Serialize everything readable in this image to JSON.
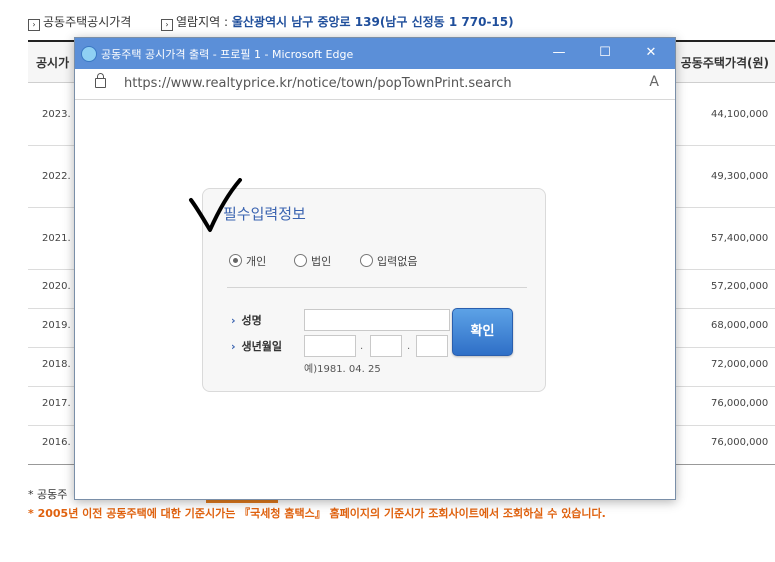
{
  "header": {
    "price_label": "공동주택공시가격",
    "location_label": "열람지역 :",
    "location_value": "울산광역시 남구 중앙로 139(남구 신정동 1 770-15)"
  },
  "table": {
    "col_year": "공시가",
    "col_price": "공동주택가격(원)",
    "rows": [
      {
        "year": "2023.",
        "price": "44,100,000"
      },
      {
        "year": "2022.",
        "price": "49,300,000"
      },
      {
        "year": "2021.",
        "price": "57,400,000"
      },
      {
        "year": "2020.",
        "price": "57,200,000"
      },
      {
        "year": "2019.",
        "price": "68,000,000"
      },
      {
        "year": "2018.",
        "price": "72,000,000"
      },
      {
        "year": "2017.",
        "price": "76,000,000"
      },
      {
        "year": "2016.",
        "price": "76,000,000"
      }
    ]
  },
  "notes": {
    "note1": "* 공동주",
    "note2": "* 2005년 이전 공동주택에 대한 기준시가는 『국세청 홈택스』 홈페이지의 기준시가 조회사이트에서 조회하실 수 있습니다."
  },
  "popup": {
    "title": "공동주택 공시가격 출력 - 프로필 1 - Microsoft Edge",
    "url": "https://www.realtyprice.kr/notice/town/popTownPrint.search",
    "minimize": "—",
    "maximize": "☐",
    "close": "✕",
    "read_aloud": "A"
  },
  "form": {
    "title": "필수입력정보",
    "options": [
      "개인",
      "법인",
      "입력없음"
    ],
    "selected": "개인",
    "name_label": "성명",
    "birth_label": "생년월일",
    "name_value": "",
    "birth_year": "",
    "birth_month": "",
    "birth_day": "",
    "date_sep": ".",
    "example": "예)1981. 04. 25",
    "confirm": "확인"
  },
  "colors": {
    "titlebar": "#5b8fd8",
    "accent": "#3a63b0",
    "warning": "#e0620f",
    "button": "#2f6fc7"
  }
}
